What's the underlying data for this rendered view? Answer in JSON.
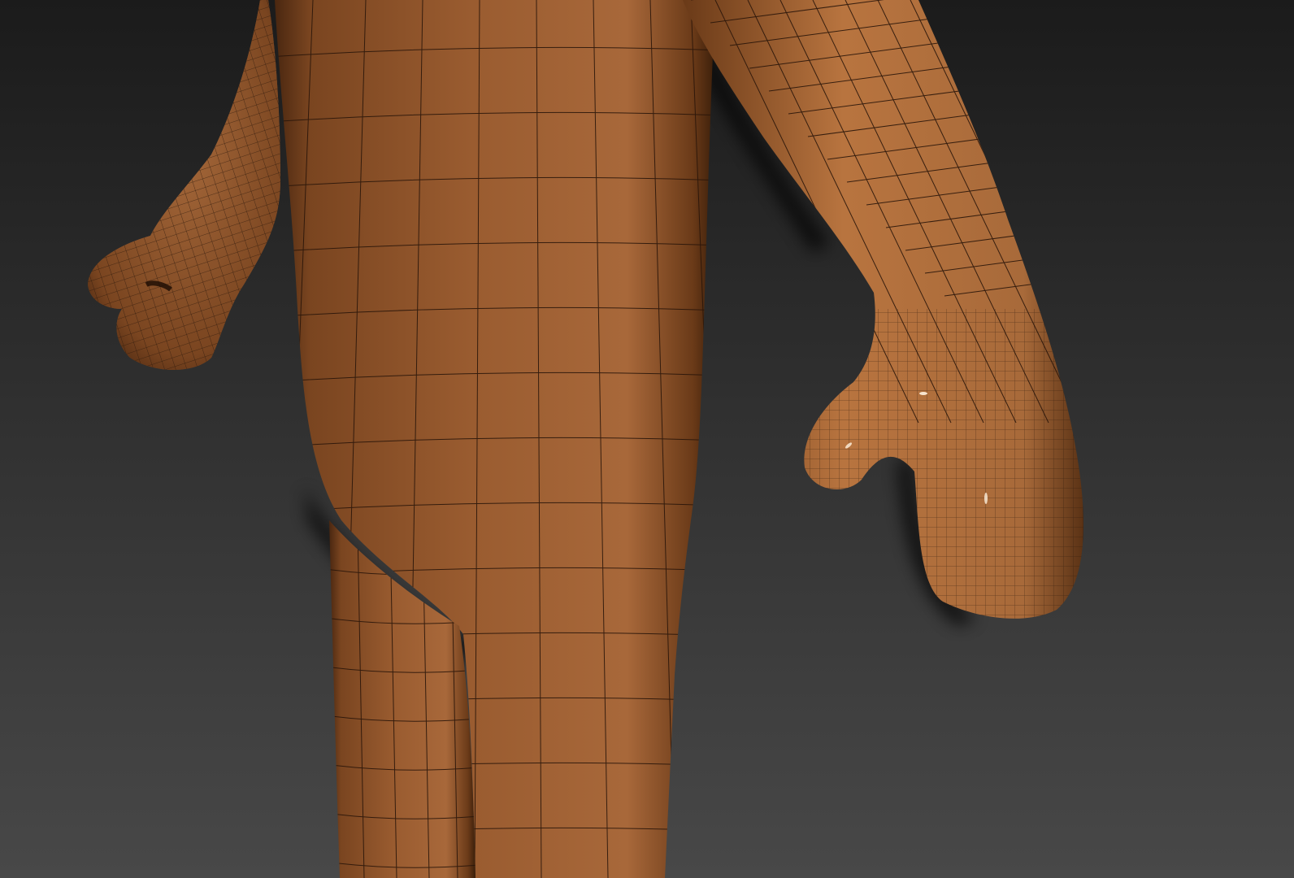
{
  "viewport": {
    "background_top": "#1b1b1b",
    "background_bottom": "#484848",
    "model_color": "#9a5c30",
    "model_light": "#b8743f",
    "model_dark": "#5a3215",
    "wire_color": "#2a160a",
    "icons": [
      "character-body-mesh",
      "wireframe-grid"
    ]
  }
}
